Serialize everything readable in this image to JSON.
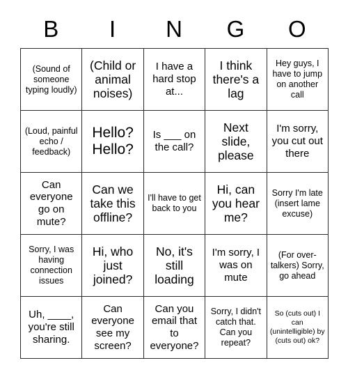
{
  "card": {
    "header_letters": [
      "B",
      "I",
      "N",
      "G",
      "O"
    ],
    "rows": [
      [
        {
          "text": "(Sound of someone typing loudly)",
          "size": "fs-sm"
        },
        {
          "text": "(Child or animal noises)",
          "size": "fs-lg"
        },
        {
          "text": "I have a hard stop at...",
          "size": "fs-md"
        },
        {
          "text": "I think there's a lag",
          "size": "fs-lg"
        },
        {
          "text": "Hey guys, I have to jump on another call",
          "size": "fs-sm"
        }
      ],
      [
        {
          "text": "(Loud, painful echo / feedback)",
          "size": "fs-sm"
        },
        {
          "text": "Hello? Hello?",
          "size": "fs-xl"
        },
        {
          "text": "Is ___ on the call?",
          "size": "fs-md"
        },
        {
          "text": "Next slide, please",
          "size": "fs-lg"
        },
        {
          "text": "I'm sorry, you cut out there",
          "size": "fs-md"
        }
      ],
      [
        {
          "text": "Can everyone go on mute?",
          "size": "fs-md"
        },
        {
          "text": "Can we take this offline?",
          "size": "fs-lg"
        },
        {
          "text": "I'll have to get back to you",
          "size": "fs-sm"
        },
        {
          "text": "Hi, can you hear me?",
          "size": "fs-lg"
        },
        {
          "text": "Sorry I'm late (insert lame excuse)",
          "size": "fs-sm"
        }
      ],
      [
        {
          "text": "Sorry, I was having connection issues",
          "size": "fs-sm"
        },
        {
          "text": "Hi, who just joined?",
          "size": "fs-lg"
        },
        {
          "text": "No, it's still loading",
          "size": "fs-lg"
        },
        {
          "text": "I'm sorry, I was on mute",
          "size": "fs-md"
        },
        {
          "text": "(For over-talkers) Sorry, go ahead",
          "size": "fs-sm"
        }
      ],
      [
        {
          "text": "Uh, ____, you're still sharing.",
          "size": "fs-md"
        },
        {
          "text": "Can everyone see my screen?",
          "size": "fs-md"
        },
        {
          "text": "Can you email that to everyone?",
          "size": "fs-md"
        },
        {
          "text": "Sorry, I didn't catch that. Can you repeat?",
          "size": "fs-sm"
        },
        {
          "text": "So (cuts out) I can (unintelligible) by (cuts out) ok?",
          "size": "fs-xs"
        }
      ]
    ]
  }
}
